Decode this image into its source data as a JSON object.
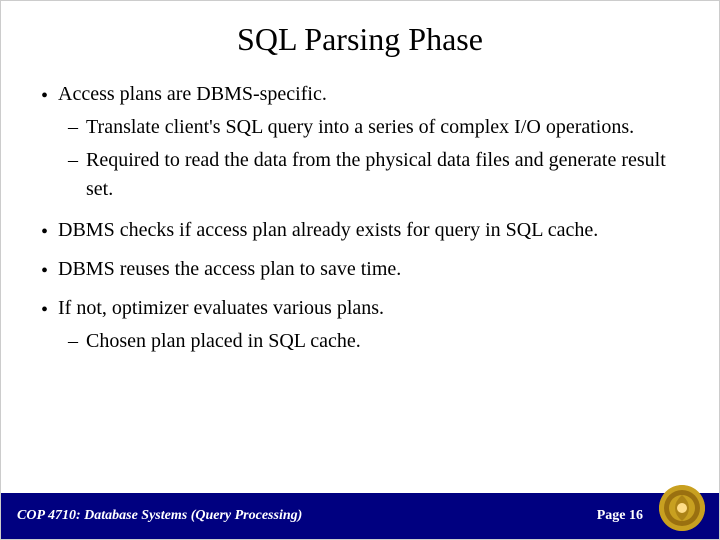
{
  "slide": {
    "title": "SQL Parsing Phase",
    "bullets": [
      {
        "id": "bullet-1",
        "text": "Access plans are DBMS-specific.",
        "sub_items": [
          {
            "id": "sub-1-1",
            "text": "Translate client's SQL query into a series of complex I/O operations."
          },
          {
            "id": "sub-1-2",
            "text": "Required to read the data from the physical data files and generate result set."
          }
        ]
      },
      {
        "id": "bullet-2",
        "text": "DBMS checks if access plan already exists for query in SQL cache.",
        "sub_items": []
      },
      {
        "id": "bullet-3",
        "text": "DBMS reuses the access plan to save time.",
        "sub_items": []
      },
      {
        "id": "bullet-4",
        "text": "If not, optimizer evaluates various plans.",
        "sub_items": [
          {
            "id": "sub-4-1",
            "text": "Chosen plan placed in SQL cache."
          }
        ]
      }
    ],
    "footer": {
      "left_text": "COP 4710: Database Systems (Query Processing)",
      "page_label": "Page 16"
    }
  }
}
